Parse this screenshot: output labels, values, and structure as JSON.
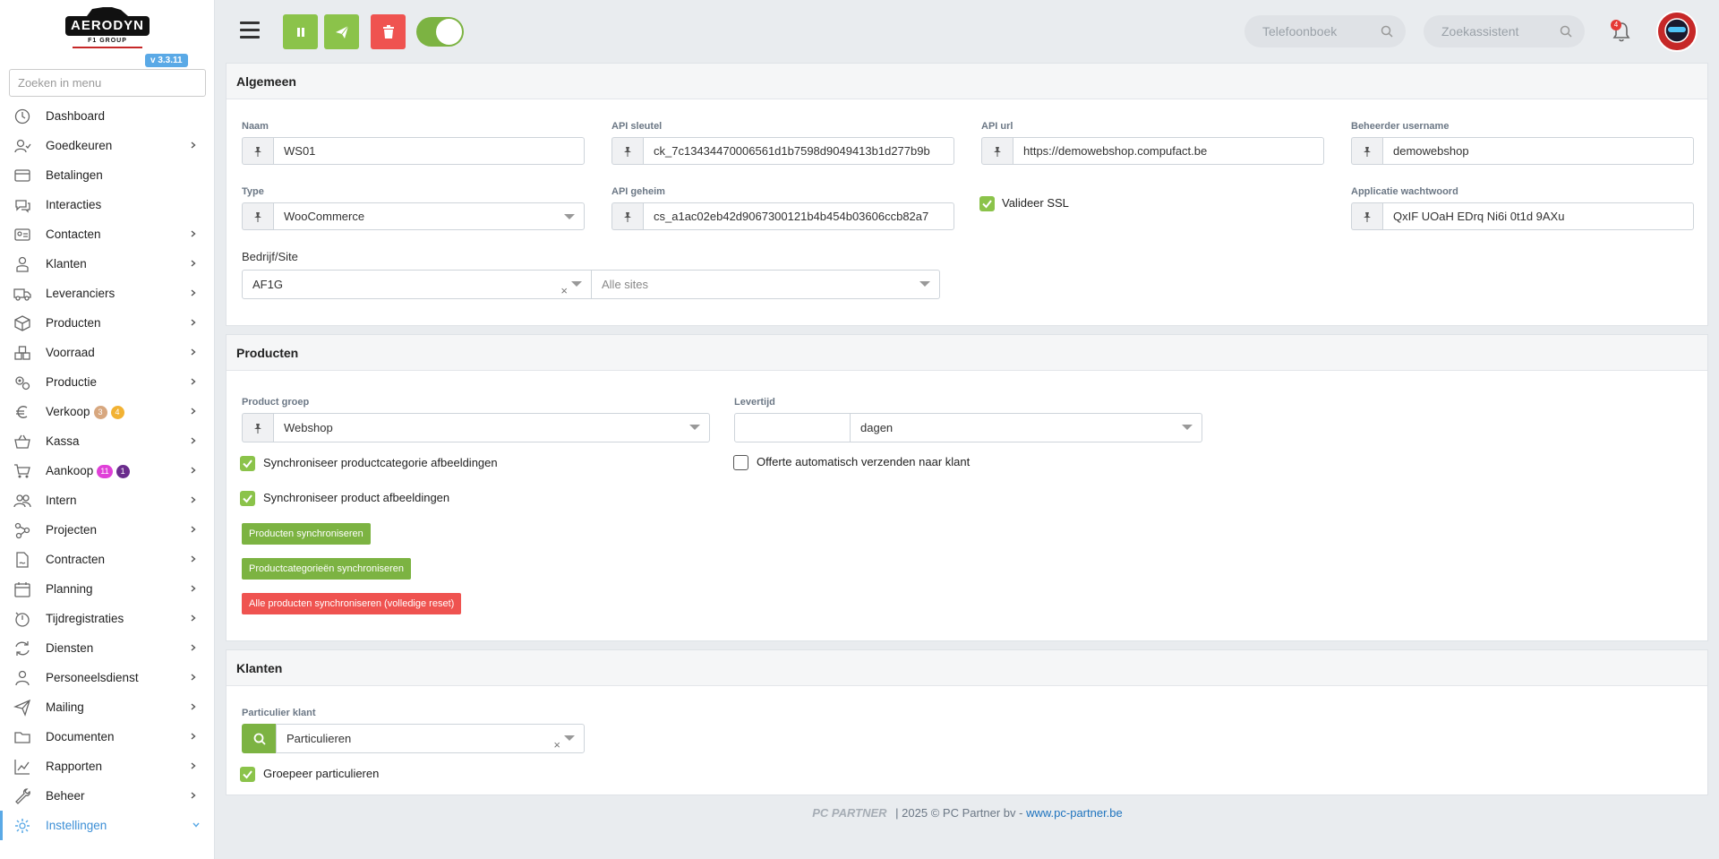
{
  "app": {
    "logo_text": "AERODYN",
    "logo_sub": "F1 GROUP",
    "version": "v 3.3.11"
  },
  "sidebar": {
    "search_placeholder": "Zoeken in menu",
    "items": [
      {
        "label": "Dashboard",
        "icon": "dashboard-icon",
        "chevron": false
      },
      {
        "label": "Goedkeuren",
        "icon": "user-check-icon",
        "chevron": true
      },
      {
        "label": "Betalingen",
        "icon": "credit-card-icon",
        "chevron": false
      },
      {
        "label": "Interacties",
        "icon": "chat-icon",
        "chevron": false
      },
      {
        "label": "Contacten",
        "icon": "id-card-icon",
        "chevron": true
      },
      {
        "label": "Klanten",
        "icon": "customer-icon",
        "chevron": true
      },
      {
        "label": "Leveranciers",
        "icon": "truck-icon",
        "chevron": true
      },
      {
        "label": "Producten",
        "icon": "box-icon",
        "chevron": true
      },
      {
        "label": "Voorraad",
        "icon": "boxes-icon",
        "chevron": true
      },
      {
        "label": "Productie",
        "icon": "gears-icon",
        "chevron": true
      },
      {
        "label": "Verkoop",
        "icon": "euro-icon",
        "chevron": true,
        "badges": [
          {
            "text": "3",
            "color": "#d7a77f"
          },
          {
            "text": "4",
            "color": "#f2b233"
          }
        ]
      },
      {
        "label": "Kassa",
        "icon": "basket-icon",
        "chevron": true
      },
      {
        "label": "Aankoop",
        "icon": "cart-icon",
        "chevron": true,
        "badges": [
          {
            "text": "11",
            "color": "#e040d8"
          },
          {
            "text": "1",
            "color": "#6a2c8c"
          }
        ]
      },
      {
        "label": "Intern",
        "icon": "users-icon",
        "chevron": true
      },
      {
        "label": "Projecten",
        "icon": "project-icon",
        "chevron": true
      },
      {
        "label": "Contracten",
        "icon": "contract-icon",
        "chevron": true
      },
      {
        "label": "Planning",
        "icon": "calendar-icon",
        "chevron": true
      },
      {
        "label": "Tijdregistraties",
        "icon": "timer-icon",
        "chevron": true
      },
      {
        "label": "Diensten",
        "icon": "refresh-icon",
        "chevron": true
      },
      {
        "label": "Personeelsdienst",
        "icon": "person-icon",
        "chevron": true
      },
      {
        "label": "Mailing",
        "icon": "send-icon",
        "chevron": true
      },
      {
        "label": "Documenten",
        "icon": "folder-icon",
        "chevron": true
      },
      {
        "label": "Rapporten",
        "icon": "chart-icon",
        "chevron": true
      },
      {
        "label": "Beheer",
        "icon": "wrench-icon",
        "chevron": true
      },
      {
        "label": "Instellingen",
        "icon": "gear-icon",
        "chevron": true,
        "active": true
      }
    ]
  },
  "topbar": {
    "phonebook_placeholder": "Telefoonboek",
    "assistant_placeholder": "Zoekassistent",
    "notification_count": "4"
  },
  "algemeen": {
    "title": "Algemeen",
    "naam_label": "Naam",
    "naam_value": "WS01",
    "api_key_label": "API sleutel",
    "api_key_value": "ck_7c13434470006561d1b7598d9049413b1d277b9b",
    "api_url_label": "API url",
    "api_url_value": "https://demowebshop.compufact.be",
    "admin_user_label": "Beheerder username",
    "admin_user_value": "demowebshop",
    "type_label": "Type",
    "type_value": "WooCommerce",
    "api_secret_label": "API geheim",
    "api_secret_value": "cs_a1ac02eb42d9067300121b4b454b03606ccb82a7",
    "validate_ssl_label": "Valideer SSL",
    "app_password_label": "Applicatie wachtwoord",
    "app_password_value": "QxIF UOaH EDrq Ni6i 0t1d 9AXu",
    "company_site_label": "Bedrijf/Site",
    "company_value": "AF1G",
    "sites_placeholder": "Alle sites"
  },
  "producten": {
    "title": "Producten",
    "product_group_label": "Product groep",
    "product_group_value": "Webshop",
    "delivery_label": "Levertijd",
    "delivery_value": "",
    "delivery_unit": "dagen",
    "sync_category_images": "Synchroniseer productcategorie afbeeldingen",
    "sync_product_images": "Synchroniseer product afbeeldingen",
    "auto_send_quote": "Offerte automatisch verzenden naar klant",
    "btn_sync_products": "Producten synchroniseren",
    "btn_sync_categories": "Productcategorieën synchroniseren",
    "btn_full_reset": "Alle producten synchroniseren (volledige reset)"
  },
  "klanten": {
    "title": "Klanten",
    "private_customer_label": "Particulier klant",
    "private_customer_value": "Particulieren",
    "group_private_label": "Groepeer particulieren"
  },
  "footer": {
    "brand": "PC PARTNER",
    "separator": "|",
    "copyright": "2025 © PC Partner bv - ",
    "link": "www.pc-partner.be"
  },
  "colors": {
    "accent_green": "#8bc34a",
    "danger_red": "#ef5350",
    "active_blue": "#3d8fd6"
  }
}
